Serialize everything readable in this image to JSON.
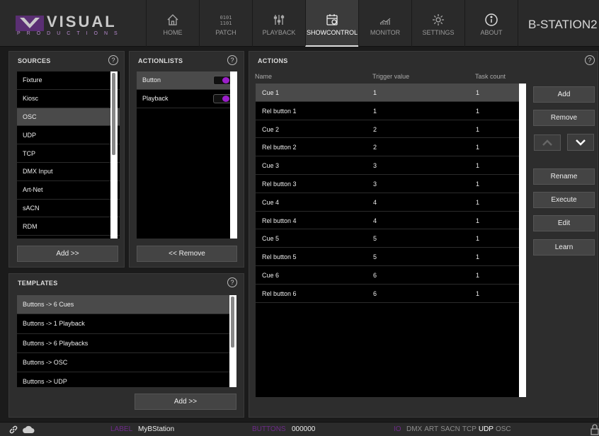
{
  "header": {
    "logo_word": "VISUAL",
    "logo_sub": "PRODUCTIONS",
    "device_name": "B-STATION2",
    "nav": [
      {
        "label": "HOME",
        "icon": "home-icon"
      },
      {
        "label": "PATCH",
        "icon": "binary-icon",
        "glyph": "0101\n1101"
      },
      {
        "label": "PLAYBACK",
        "icon": "faders-icon"
      },
      {
        "label": "SHOWCONTROL",
        "icon": "calendar-icon",
        "active": true
      },
      {
        "label": "MONITOR",
        "icon": "monitor-chart-icon"
      },
      {
        "label": "SETTINGS",
        "icon": "gear-icon"
      },
      {
        "label": "ABOUT",
        "icon": "info-icon"
      }
    ]
  },
  "sources": {
    "title": "SOURCES",
    "items": [
      "Fixture",
      "Kiosc",
      "OSC",
      "UDP",
      "TCP",
      "DMX Input",
      "Art-Net",
      "sACN",
      "RDM"
    ],
    "selected": 2,
    "add_label": "Add >>"
  },
  "actionlists": {
    "title": "ACTIONLISTS",
    "items": [
      "Button",
      "Playback"
    ],
    "selected": 0,
    "remove_label": "<< Remove"
  },
  "templates": {
    "title": "TEMPLATES",
    "items": [
      "Buttons -> 6 Cues",
      "Buttons -> 1 Playback",
      "Buttons -> 6 Playbacks",
      "Buttons -> OSC",
      "Buttons -> UDP"
    ],
    "selected": 0,
    "add_label": "Add >>"
  },
  "actions": {
    "title": "ACTIONS",
    "columns": [
      "Name",
      "Trigger value",
      "Task count"
    ],
    "rows": [
      [
        "Cue 1",
        "1",
        "1"
      ],
      [
        "Rel button 1",
        "1",
        "1"
      ],
      [
        "Cue 2",
        "2",
        "1"
      ],
      [
        "Rel button 2",
        "2",
        "1"
      ],
      [
        "Cue 3",
        "3",
        "1"
      ],
      [
        "Rel button 3",
        "3",
        "1"
      ],
      [
        "Cue 4",
        "4",
        "1"
      ],
      [
        "Rel button 4",
        "4",
        "1"
      ],
      [
        "Cue 5",
        "5",
        "1"
      ],
      [
        "Rel button 5",
        "5",
        "1"
      ],
      [
        "Cue 6",
        "6",
        "1"
      ],
      [
        "Rel button 6",
        "6",
        "1"
      ]
    ],
    "selected": 0,
    "buttons": {
      "add": "Add",
      "remove": "Remove",
      "rename": "Rename",
      "execute": "Execute",
      "edit": "Edit",
      "learn": "Learn"
    }
  },
  "status": {
    "label_label": "LABEL",
    "label_value": "MyBStation",
    "buttons_label": "BUTTONS",
    "buttons_value": "000000",
    "io_label": "IO",
    "protocols": [
      {
        "name": "DMX",
        "active": false
      },
      {
        "name": "ART",
        "active": false
      },
      {
        "name": "SACN",
        "active": false
      },
      {
        "name": "TCP",
        "active": false
      },
      {
        "name": "UDP",
        "active": true
      },
      {
        "name": "OSC",
        "active": false
      }
    ]
  },
  "colors": {
    "accent": "#9b1fc9",
    "status_label": "#6e2a8a"
  }
}
